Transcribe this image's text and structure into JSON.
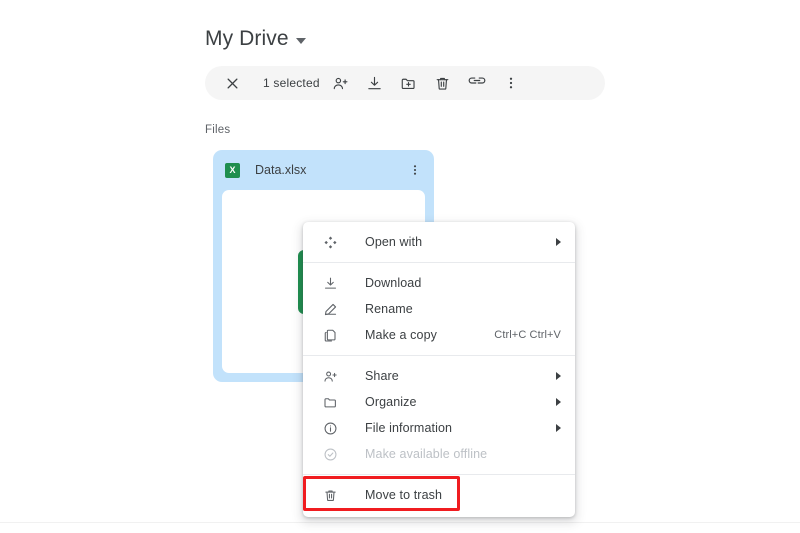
{
  "header": {
    "title": "My Drive",
    "caret_icon": "chevron-down-icon"
  },
  "selection_toolbar": {
    "close_icon": "close-icon",
    "count_label": "1 selected",
    "actions": [
      {
        "name": "share-add-person",
        "icon": "person-add-icon"
      },
      {
        "name": "download",
        "icon": "download-icon"
      },
      {
        "name": "move-to-folder",
        "icon": "folder-add-icon"
      },
      {
        "name": "move-to-trash",
        "icon": "trash-icon"
      },
      {
        "name": "get-link",
        "icon": "link-icon"
      },
      {
        "name": "more-actions",
        "icon": "more-vertical-icon"
      }
    ]
  },
  "section": {
    "files_label": "Files"
  },
  "file_card": {
    "file_name": "Data.xlsx",
    "file_type_icon": "excel-icon",
    "file_type_letter": "X",
    "kebab_icon": "more-vertical-icon",
    "selected": true,
    "selection_color": "#c2e2fb",
    "excel_green": "#1e8e4e"
  },
  "context_menu": {
    "groups": [
      {
        "items": [
          {
            "label": "Open with",
            "icon": "open-with-icon",
            "submenu": true,
            "accel": "",
            "disabled": false
          }
        ]
      },
      {
        "items": [
          {
            "label": "Download",
            "icon": "download-icon",
            "submenu": false,
            "accel": "",
            "disabled": false
          },
          {
            "label": "Rename",
            "icon": "pencil-icon",
            "submenu": false,
            "accel": "",
            "disabled": false
          },
          {
            "label": "Make a copy",
            "icon": "copy-icon",
            "submenu": false,
            "accel": "Ctrl+C Ctrl+V",
            "disabled": false
          }
        ]
      },
      {
        "items": [
          {
            "label": "Share",
            "icon": "person-add-icon",
            "submenu": true,
            "accel": "",
            "disabled": false
          },
          {
            "label": "Organize",
            "icon": "folder-icon",
            "submenu": true,
            "accel": "",
            "disabled": false
          },
          {
            "label": "File information",
            "icon": "info-circle-icon",
            "submenu": true,
            "accel": "",
            "disabled": false
          },
          {
            "label": "Make available offline",
            "icon": "offline-pin-icon",
            "submenu": false,
            "accel": "",
            "disabled": true
          }
        ]
      },
      {
        "items": [
          {
            "label": "Move to trash",
            "icon": "trash-icon",
            "submenu": false,
            "accel": "",
            "disabled": false
          }
        ]
      }
    ]
  },
  "annotation": {
    "target_label": "Move to trash",
    "color": "#f01c20"
  }
}
